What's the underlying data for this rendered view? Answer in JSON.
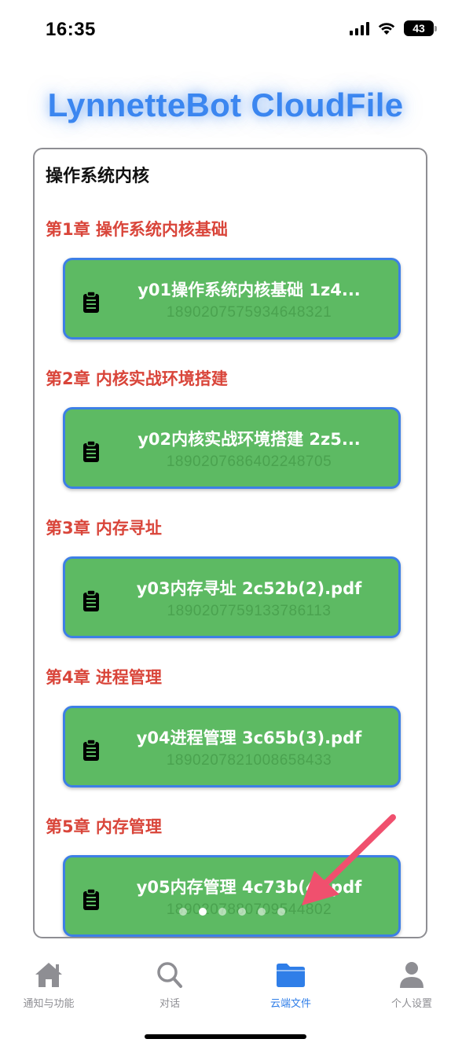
{
  "status_bar": {
    "time": "16:35",
    "battery": "43"
  },
  "app_title": "LynnetteBot CloudFile",
  "panel": {
    "heading": "操作系统内核",
    "chapters": [
      {
        "title": "第1章 操作系统内核基础",
        "file_name": "y01操作系统内核基础 1z4...",
        "file_id": "1890207575934648321"
      },
      {
        "title": "第2章 内核实战环境搭建",
        "file_name": "y02内核实战环境搭建 2z5...",
        "file_id": "1890207686402248705"
      },
      {
        "title": "第3章 内存寻址",
        "file_name": "y03内存寻址 2c52b(2).pdf",
        "file_id": "1890207759133786113"
      },
      {
        "title": "第4章 进程管理",
        "file_name": "y04进程管理 3c65b(3).pdf",
        "file_id": "1890207821008658433"
      },
      {
        "title": "第5章 内存管理",
        "file_name": "y05内存管理 4c73b(4).pdf",
        "file_id": "1890207880709544802"
      }
    ]
  },
  "pager": {
    "count": 6,
    "active_index": 1
  },
  "tabbar": {
    "tabs": [
      {
        "label": "通知与功能",
        "icon": "home-icon",
        "active": false
      },
      {
        "label": "对话",
        "icon": "search-icon",
        "active": false
      },
      {
        "label": "云端文件",
        "icon": "folder-icon",
        "active": true
      },
      {
        "label": "个人设置",
        "icon": "person-icon",
        "active": false
      }
    ]
  },
  "colors": {
    "title_blue": "#3b86f0",
    "chapter_red": "#d9453a",
    "card_green": "#5dba63",
    "card_border": "#3d7fe6",
    "tab_active": "#2f7ee8",
    "annotation_arrow": "#f0506e"
  }
}
